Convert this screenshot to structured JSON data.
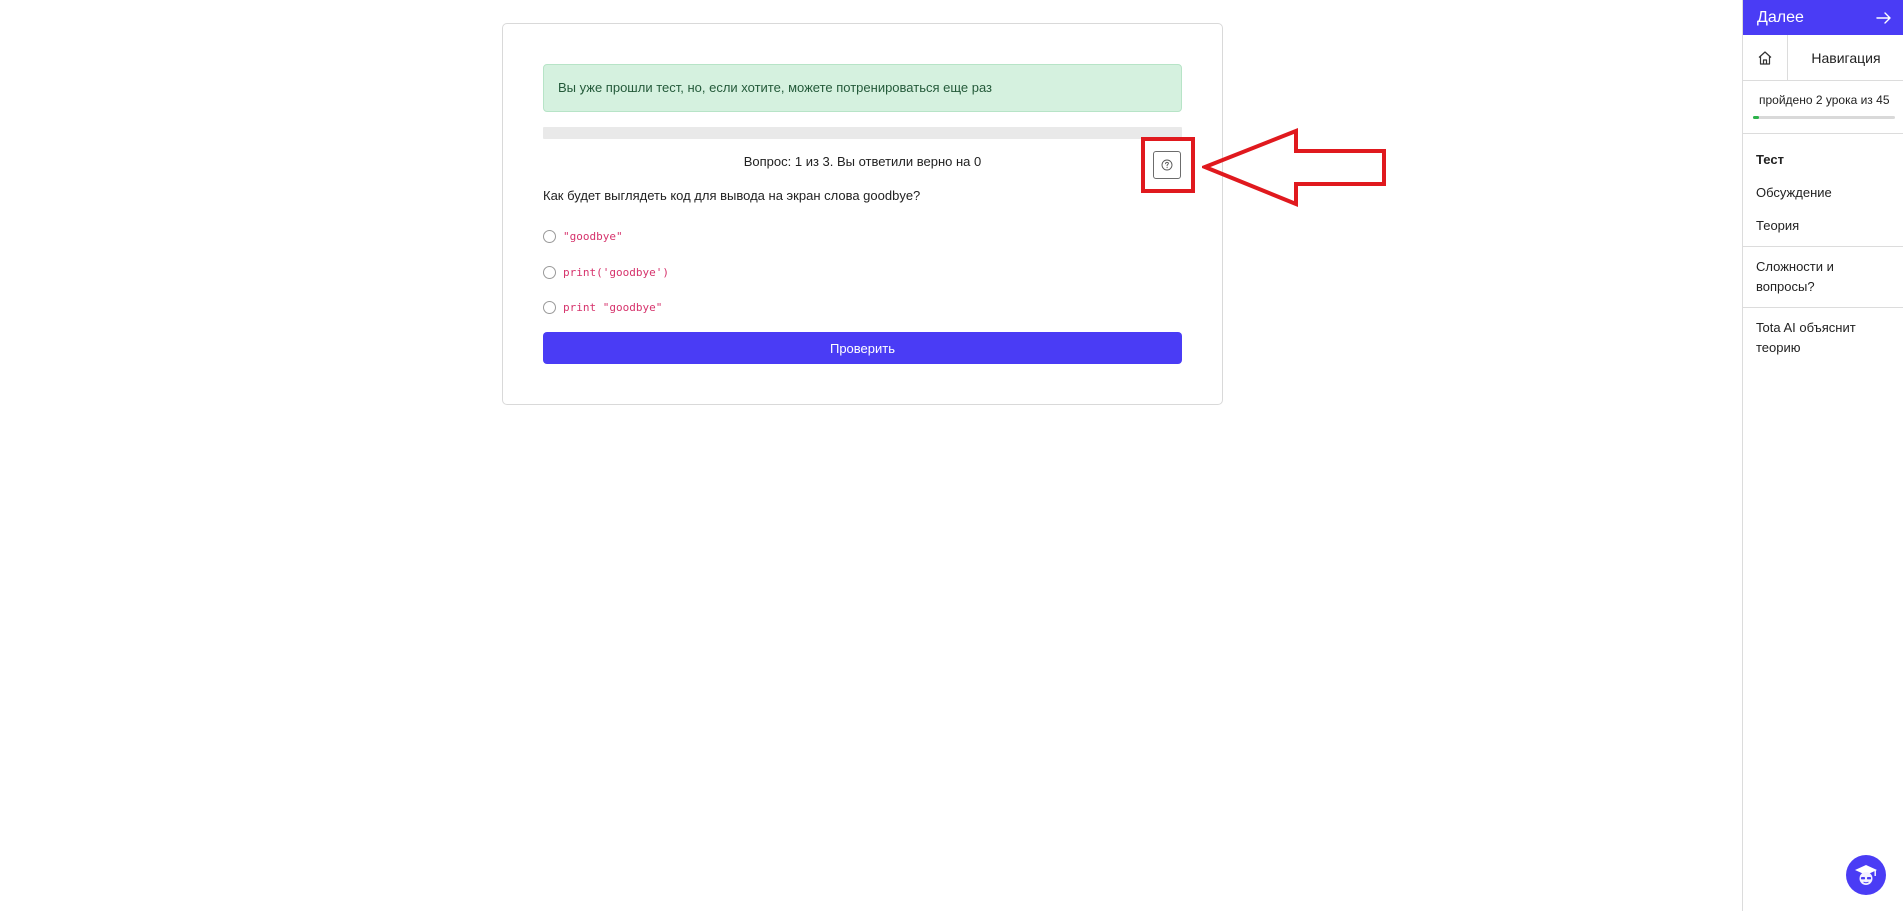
{
  "quiz": {
    "alert_text": "Вы уже прошли тест, но, если хотите, можете потренироваться еще раз",
    "progress_fraction": 0,
    "counter_text": "Вопрос: 1 из 3. Вы ответили верно на 0",
    "help_icon": "question-circle-icon",
    "question_text": "Как будет выглядеть код для вывода на экран слова goodbye?",
    "options": [
      {
        "label": "\"goodbye\""
      },
      {
        "label": "print('goodbye')"
      },
      {
        "label": "print \"goodbye\""
      }
    ],
    "submit_label": "Проверить"
  },
  "annotation": {
    "color": "#e0191e",
    "target": "help-button"
  },
  "sidebar": {
    "next_label": "Далее",
    "next_icon": "arrow-right-icon",
    "home_icon": "home-icon",
    "nav_label": "Навигация",
    "lessons_text": "пройдено 2 урока из 45",
    "lessons_progress_fraction": 0.044,
    "links": [
      {
        "label": "Тест",
        "active": true
      },
      {
        "label": "Обсуждение",
        "active": false
      },
      {
        "label": "Теория",
        "active": false
      },
      {
        "label": "Сложности и вопросы?",
        "active": false
      },
      {
        "label": "Tota AI объяснит теорию",
        "active": false
      }
    ]
  },
  "assistant": {
    "icon": "graduate-avatar-icon"
  },
  "colors": {
    "accent": "#4a3cf5",
    "alert_bg": "#d5f1df",
    "success": "#2bb34a",
    "code": "#d6336c"
  }
}
